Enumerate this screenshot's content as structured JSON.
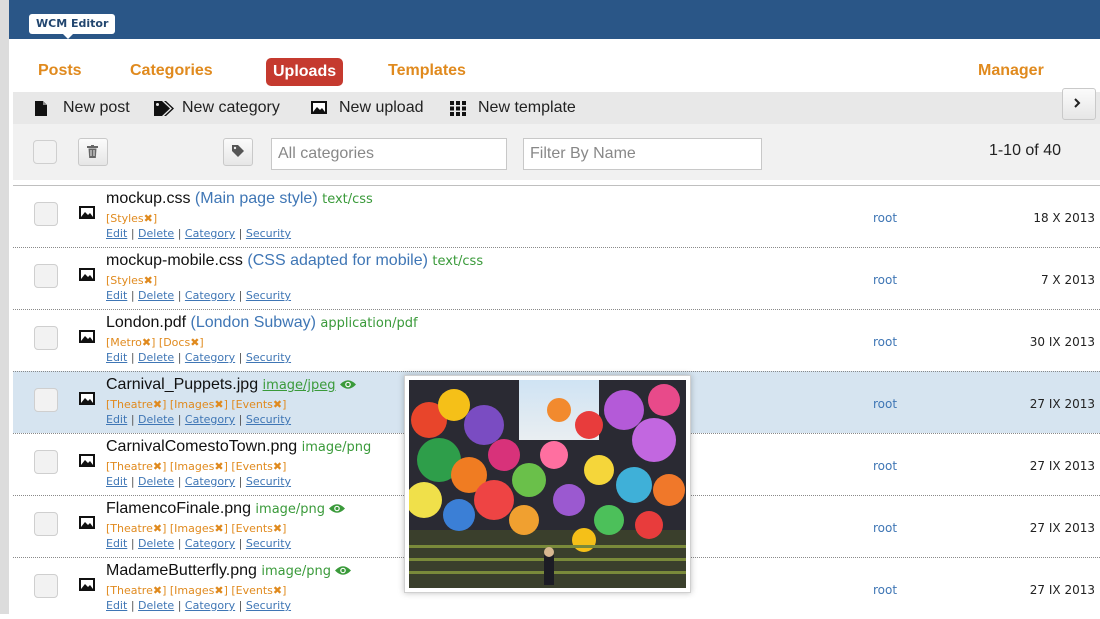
{
  "brand": "WCM Editor",
  "tabs": [
    {
      "label": "Posts",
      "active": false
    },
    {
      "label": "Categories",
      "active": false
    },
    {
      "label": "Uploads",
      "active": true
    },
    {
      "label": "Templates",
      "active": false
    }
  ],
  "manager_tab": "Manager",
  "toolbar": {
    "new_post": "New post",
    "new_category": "New category",
    "new_upload": "New upload",
    "new_template": "New template"
  },
  "filter": {
    "categories_placeholder": "All categories",
    "name_placeholder": "Filter By Name",
    "pagination": "1-10 of 40"
  },
  "actions": {
    "edit": "Edit",
    "delete": "Delete",
    "category": "Category",
    "security": "Security",
    "sep": "|"
  },
  "rows": [
    {
      "name": "mockup.css",
      "desc": "(Main page style)",
      "mime": "text/css",
      "cats": [
        "Styles"
      ],
      "owner": "root",
      "date": "18 X 2013"
    },
    {
      "name": "mockup-mobile.css",
      "desc": "(CSS adapted for mobile)",
      "mime": "text/css",
      "cats": [
        "Styles"
      ],
      "owner": "root",
      "date": "7 X 2013"
    },
    {
      "name": "London.pdf",
      "desc": "(London Subway)",
      "mime": "application/pdf",
      "cats": [
        "Metro",
        "Docs"
      ],
      "owner": "root",
      "date": "30 IX 2013"
    },
    {
      "name": "Carnival_Puppets.jpg",
      "desc": "",
      "mime": "image/jpeg",
      "cats": [
        "Theatre",
        "Images",
        "Events"
      ],
      "owner": "root",
      "date": "27 IX 2013"
    },
    {
      "name": "CarnivalComestoTown.png",
      "desc": "",
      "mime": "image/png",
      "cats": [
        "Theatre",
        "Images",
        "Events"
      ],
      "owner": "root",
      "date": "27 IX 2013"
    },
    {
      "name": "FlamencoFinale.png",
      "desc": "",
      "mime": "image/png",
      "cats": [
        "Theatre",
        "Images",
        "Events"
      ],
      "owner": "root",
      "date": "27 IX 2013"
    },
    {
      "name": "MadameButterfly.png",
      "desc": "",
      "mime": "image/png",
      "cats": [
        "Theatre",
        "Images",
        "Events"
      ],
      "owner": "root",
      "date": "27 IX 2013"
    }
  ],
  "colors": {
    "header": "#2a5687",
    "tab_text": "#e08a1e",
    "active_tab": "#c53a2f",
    "mime": "#3a9a3a",
    "link": "#3f76b5",
    "highlight_row": "#d6e4f0"
  }
}
